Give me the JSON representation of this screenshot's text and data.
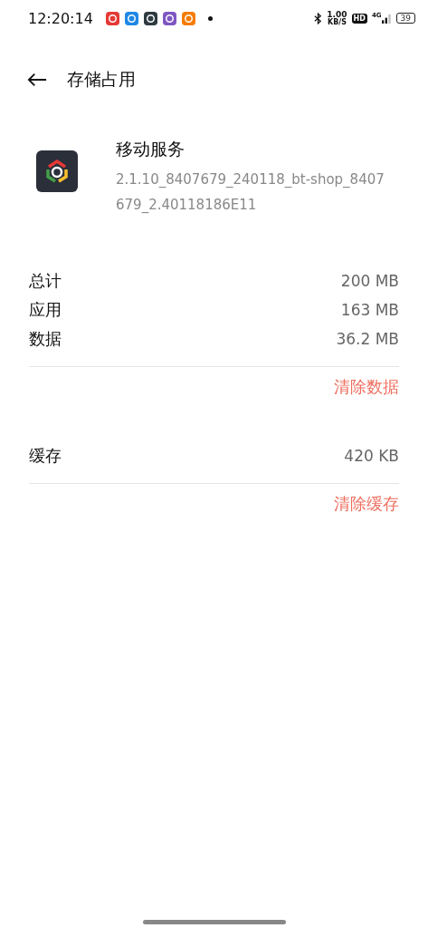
{
  "status_bar": {
    "time": "12:20:14",
    "notification_icons": [
      {
        "color": "#e53935"
      },
      {
        "color": "#1e88e5"
      },
      {
        "color": "#2e3b40"
      },
      {
        "color": "#7e57c2"
      },
      {
        "color": "#f57c00"
      }
    ],
    "speed_value": "1.00",
    "speed_unit": "KB/S",
    "hd": "HD",
    "network": "4G",
    "battery": "39"
  },
  "header": {
    "title": "存储占用"
  },
  "app": {
    "name": "移动服务",
    "version": "2.1.10_8407679_240118_bt-shop_8407679_2.40118186E11"
  },
  "data_rows": [
    {
      "label": "总计",
      "value": "200 MB"
    },
    {
      "label": "应用",
      "value": "163 MB"
    },
    {
      "label": "数据",
      "value": "36.2 MB"
    }
  ],
  "clear_data": "清除数据",
  "cache_row": {
    "label": "缓存",
    "value": "420 KB"
  },
  "clear_cache": "清除缓存"
}
